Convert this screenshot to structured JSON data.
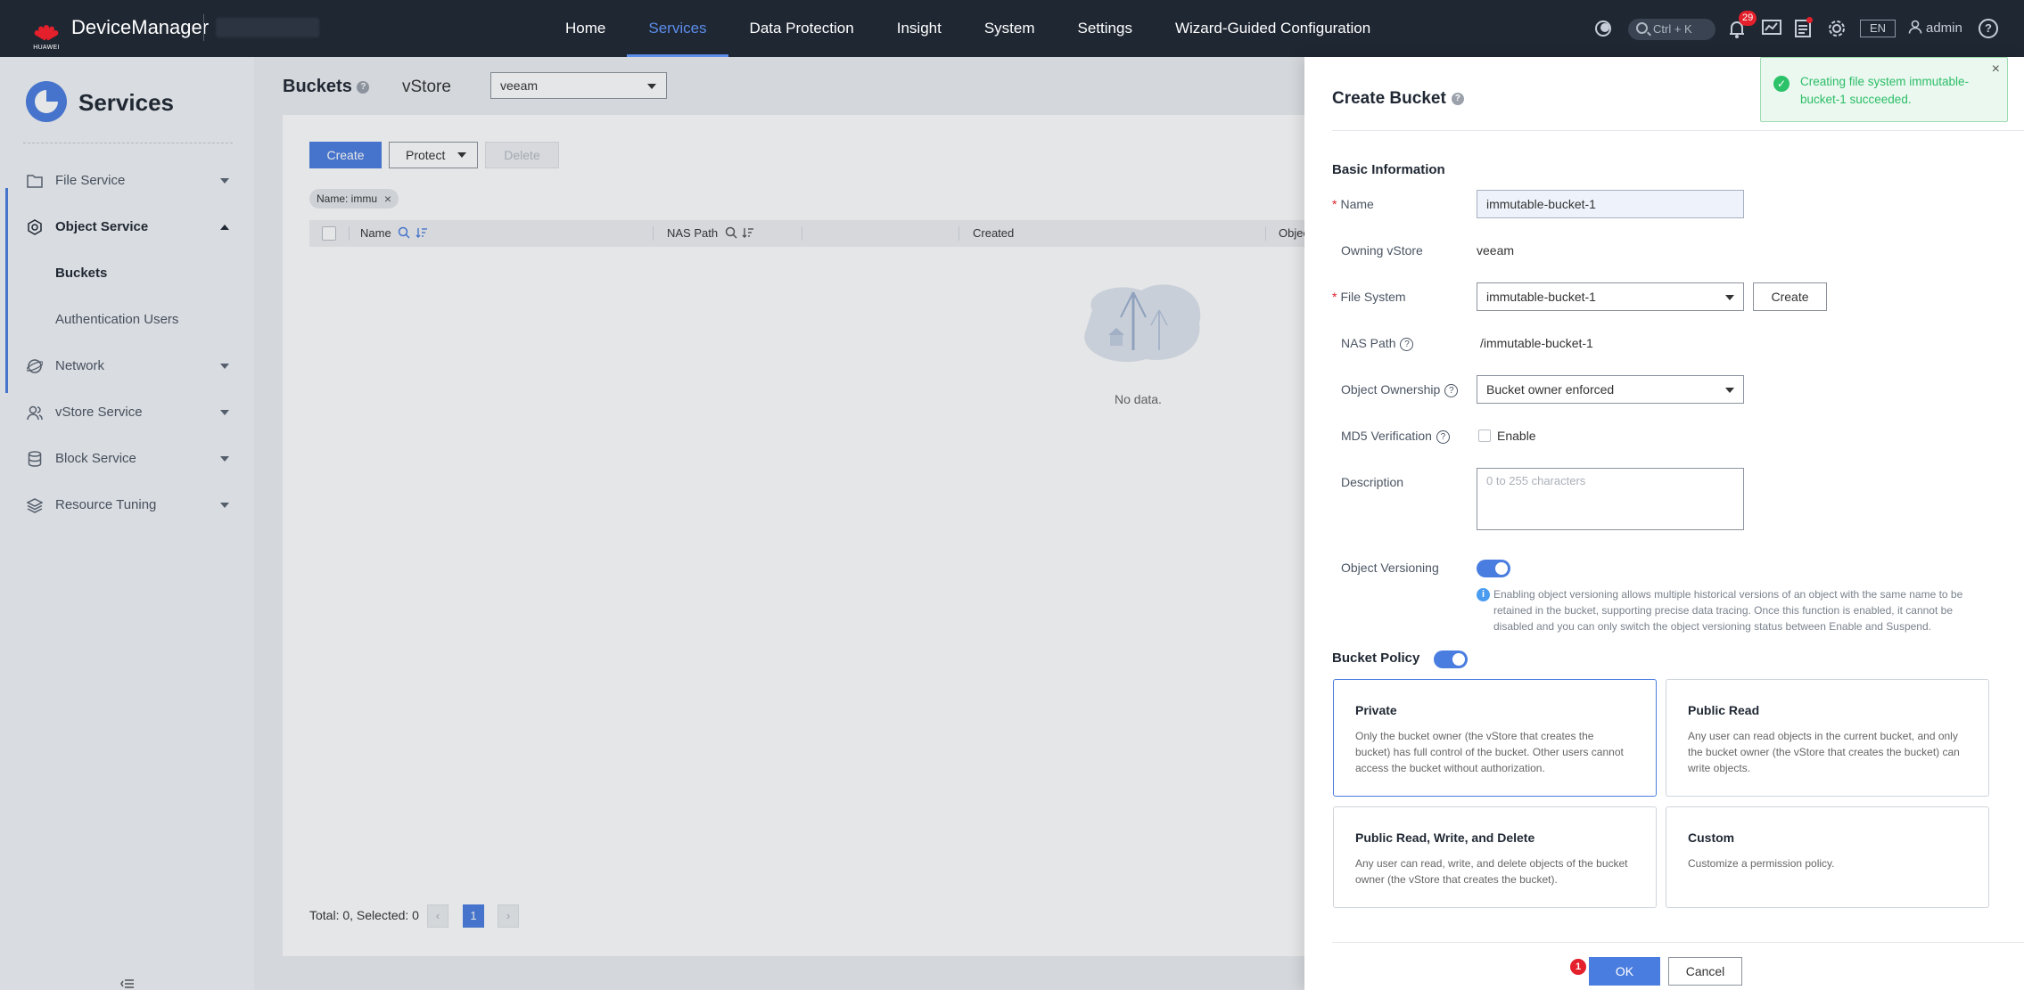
{
  "topbar": {
    "brand": "HUAWEI",
    "app_name": "DeviceManager",
    "nav": [
      "Home",
      "Services",
      "Data Protection",
      "Insight",
      "System",
      "Settings",
      "Wizard-Guided Configuration"
    ],
    "active_nav": "Services",
    "search_shortcut": "Ctrl + K",
    "alarm_count": "29",
    "language": "EN",
    "user": "admin"
  },
  "sidebar": {
    "title": "Services",
    "items": {
      "file_service": "File Service",
      "object_service": "Object Service",
      "buckets": "Buckets",
      "auth_users": "Authentication Users",
      "network": "Network",
      "vstore_service": "vStore Service",
      "block_service": "Block Service",
      "resource_tuning": "Resource Tuning"
    }
  },
  "main": {
    "title": "Buckets",
    "vstore_label": "vStore",
    "vstore_value": "veeam",
    "buttons": {
      "create": "Create",
      "protect": "Protect",
      "delete": "Delete"
    },
    "filter_tag": "Name: immu",
    "columns": [
      "Name",
      "NAS Path",
      "Created",
      "Object"
    ],
    "empty_text": "No data.",
    "total": "Total: 0, Selected: 0",
    "page": "1"
  },
  "drawer": {
    "title": "Create Bucket",
    "section_basic": "Basic Information",
    "labels": {
      "name": "Name",
      "owning_vstore": "Owning vStore",
      "file_system": "File System",
      "nas_path": "NAS Path",
      "object_ownership": "Object Ownership",
      "md5": "MD5 Verification",
      "description": "Description",
      "object_versioning": "Object Versioning"
    },
    "values": {
      "name": "immutable-bucket-1",
      "owning_vstore": "veeam",
      "file_system": "immutable-bucket-1",
      "file_system_create": "Create",
      "nas_path": "/immutable-bucket-1",
      "object_ownership": "Bucket owner enforced",
      "md5_enable": "Enable",
      "description_placeholder": "0 to 255 characters",
      "object_versioning_on": true
    },
    "versioning_info": "Enabling object versioning allows multiple historical versions of an object with the same name to be retained in the bucket, supporting precise data tracing. Once this function is enabled, it cannot be disabled and you can only switch the object versioning status between Enable and Suspend.",
    "bucket_policy_label": "Bucket Policy",
    "policies": [
      {
        "title": "Private",
        "desc": "Only the bucket owner (the vStore that creates the bucket) has full control of the bucket. Other users cannot access the bucket without authorization.",
        "selected": true
      },
      {
        "title": "Public Read",
        "desc": "Any user can read objects in the current bucket, and only the bucket owner (the vStore that creates the bucket) can write objects.",
        "selected": false
      },
      {
        "title": "Public Read, Write, and Delete",
        "desc": "Any user can read, write, and delete objects of the bucket owner (the vStore that creates the bucket).",
        "selected": false
      },
      {
        "title": "Custom",
        "desc": "Customize a permission policy.",
        "selected": false
      }
    ],
    "ok": "OK",
    "cancel": "Cancel",
    "ok_badge": "1"
  },
  "toast": {
    "message": "Creating file system immutable-bucket-1 succeeded."
  },
  "colors": {
    "topbar": "#1f2733",
    "accent": "#4a7de0",
    "success": "#2cbd67",
    "alert": "#e3202b"
  }
}
